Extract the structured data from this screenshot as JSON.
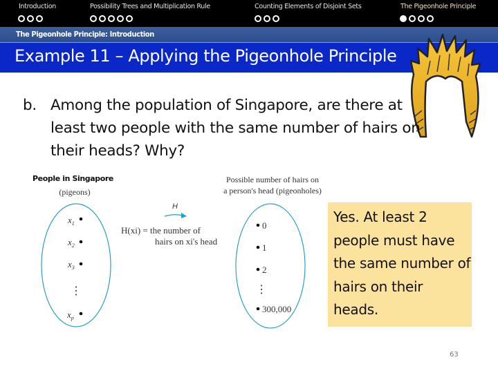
{
  "nav": {
    "sections": [
      {
        "label": "Introduction",
        "dots": 3,
        "filled": [],
        "active": false
      },
      {
        "label": "Possibility Trees and Multiplication Rule",
        "dots": 5,
        "filled": [],
        "active": false
      },
      {
        "label": "Counting Elements of Disjoint Sets",
        "dots": 3,
        "filled": [],
        "active": false
      },
      {
        "label": "The Pigeonhole Principle",
        "dots": 4,
        "filled": [
          0
        ],
        "active": true
      }
    ]
  },
  "subheader": "The Pigeonhole Principle: Introduction",
  "title": "Example 11 – Applying the Pigeonhole Principle",
  "question": {
    "label": "b.",
    "text": "Among the population of Singapore, are there at least two people with the same number of hairs on their heads? Why?"
  },
  "diagram": {
    "left_title": "People in Singapore",
    "left_subtitle": "(pigeons)",
    "left_items": [
      "x1",
      "x2",
      "x3",
      "xp"
    ],
    "arrow_label": "H",
    "function_line1": "H(xi) = the number of",
    "function_line2": "hairs on xi's head",
    "right_title_line1": "Possible number of hairs on",
    "right_title_line2": "a person's head (pigeonholes)",
    "right_items": [
      "0",
      "1",
      "2",
      "300,000"
    ],
    "ellipsis": "⋮",
    "ellipse_color": "#2a9fc4",
    "arrow_color": "#1aa0d8"
  },
  "answer": {
    "text": "Yes. At least 2 people must have the same number of hairs on their heads.",
    "background": "#fce39d"
  },
  "page_number": "63"
}
